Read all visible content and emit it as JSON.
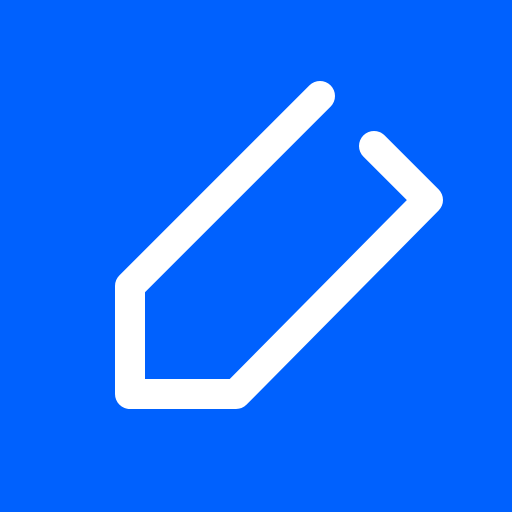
{
  "icon": {
    "name": "pencil-edit-icon",
    "background_color": "#0061FE",
    "stroke_color": "#FFFFFF"
  }
}
